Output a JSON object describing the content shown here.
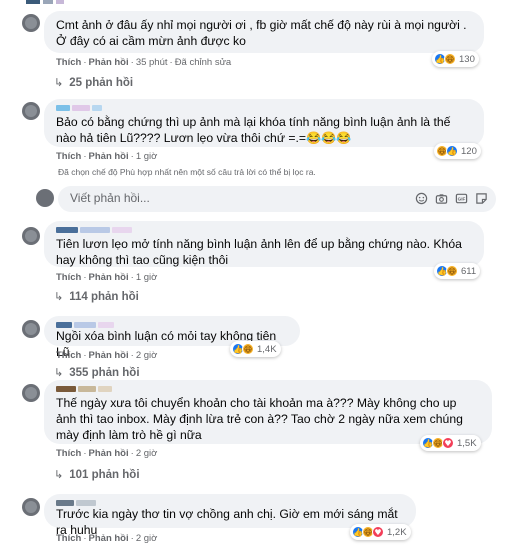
{
  "labels": {
    "like": "Thích",
    "reply": "Phản hồi",
    "edited": "Đã chỉnh sửa"
  },
  "colors": {
    "bubble": "#f0f2f5",
    "meta_text": "#65676b",
    "like_blue": "#1877f2",
    "haha_yellow": "#f7b125",
    "love_red": "#f33e58"
  },
  "comments": [
    {
      "text": "Cmt ảnh ở đâu ấy nhỉ mọi người ơi , fb giờ mất chế độ này rùi à mọi người . Ở đây có ai cầm mừn ảnh được ko",
      "time": "35 phút",
      "reactions": [
        "like-icon",
        "haha-icon"
      ],
      "reaction_count": "130",
      "replies": "25 phản hồi"
    },
    {
      "text": "Bảo có bằng chứng thì up ảnh mà lại khóa tính năng bình luận ảnh là thế nào hả tiên Lũ???? Lươn lẹo vừa thôi chứ =.=😂😂😂",
      "time": "1 giờ",
      "reactions": [
        "haha-icon",
        "like-icon"
      ],
      "reaction_count": "120",
      "note": "Đã chọn chế độ Phù hợp nhất nên một số câu trả lời có thể bị lọc ra.",
      "reply_placeholder": "Viết phản hồi..."
    },
    {
      "text": "Tiên lươn lẹo mở tính năng bình luận ảnh lên để up bằng chứng nào. Khóa hay không thì tao cũng kiện thôi",
      "time": "1 giờ",
      "reactions": [
        "like-icon",
        "haha-icon"
      ],
      "reaction_count": "611",
      "replies": "114 phản hồi"
    },
    {
      "text": "Ngồi xóa bình luận có mỏi tay không tiên Lũ",
      "time": "2 giờ",
      "reactions": [
        "like-icon",
        "haha-icon"
      ],
      "reaction_count": "1,4K",
      "replies": "355 phản hồi"
    },
    {
      "text": "Thế ngày xưa tôi chuyển khoản cho tài khoản ma à??? Mày không cho up ảnh thì tao inbox. Mày định lừa trẻ con à?? Tao chờ 2 ngày nữa xem chúng mày định làm trò hề gì nữa",
      "time": "2 giờ",
      "reactions": [
        "like-icon",
        "haha-icon",
        "love-icon"
      ],
      "reaction_count": "1,5K",
      "replies": "101 phản hồi"
    },
    {
      "text": "Trước kia ngày thơ tin vợ chồng anh chị. Giờ em mới sáng mắt ra huhu",
      "time": "2 giờ",
      "reactions": [
        "like-icon",
        "haha-icon",
        "love-icon"
      ],
      "reaction_count": "1,2K"
    }
  ]
}
